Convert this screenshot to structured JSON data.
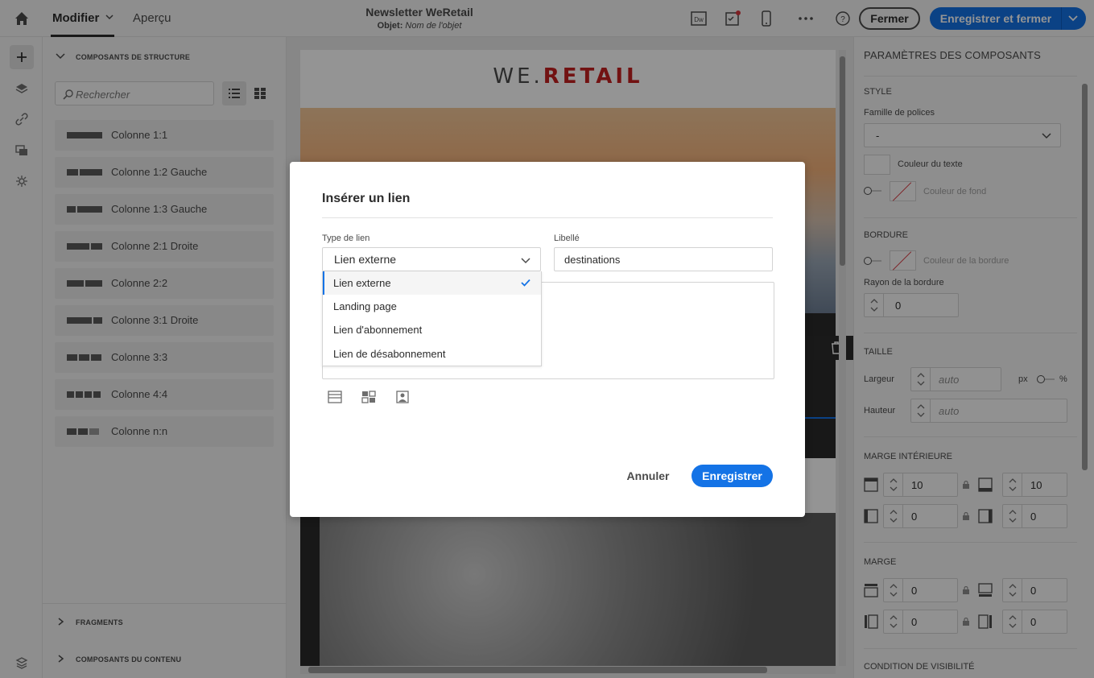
{
  "topbar": {
    "tabs": [
      {
        "label": "Modifier"
      },
      {
        "label": "Aperçu"
      }
    ],
    "doc_title": "Newsletter WeRetail",
    "subject_label": "Objet:",
    "subject_value": "Nom de l'objet",
    "close_label": "Fermer",
    "save_close_label": "Enregistrer et fermer",
    "dw_label": "Dw"
  },
  "left_panel": {
    "structure_title": "COMPOSANTS DE STRUCTURE",
    "search_placeholder": "Rechercher",
    "items": [
      {
        "label": "Colonne 1:1"
      },
      {
        "label": "Colonne 1:2 Gauche"
      },
      {
        "label": "Colonne 1:3 Gauche"
      },
      {
        "label": "Colonne 2:1 Droite"
      },
      {
        "label": "Colonne 2:2"
      },
      {
        "label": "Colonne 3:1 Droite"
      },
      {
        "label": "Colonne 3:3"
      },
      {
        "label": "Colonne 4:4"
      },
      {
        "label": "Colonne n:n"
      }
    ],
    "fragments_title": "FRAGMENTS",
    "content_title": "COMPOSANTS DU CONTENU"
  },
  "canvas": {
    "logo_left": "WE.",
    "logo_right": "RETAIL"
  },
  "right_panel": {
    "title": "PARAMÈTRES DES COMPOSANTS",
    "style": "STYLE",
    "font_family": "Famille de polices",
    "font_value": "-",
    "text_color": "Couleur du texte",
    "bg_color": "Couleur de fond",
    "border": "BORDURE",
    "border_color": "Couleur de la bordure",
    "border_radius": "Rayon de la bordure",
    "border_radius_value": "0",
    "size": "TAILLE",
    "width": "Largeur",
    "height": "Hauteur",
    "auto": "auto",
    "unit_px": "px",
    "unit_pct": "%",
    "padding": "MARGE INTÉRIEURE",
    "padding_top": "10",
    "padding_bottom": "10",
    "padding_left": "0",
    "padding_right": "0",
    "margin": "MARGE",
    "margin_top": "0",
    "margin_bottom": "0",
    "margin_left": "0",
    "margin_right": "0",
    "visibility": "CONDITION DE VISIBILITÉ"
  },
  "dialog": {
    "title": "Insérer un lien",
    "link_type_label": "Type de lien",
    "link_type_value": "Lien externe",
    "label_label": "Libellé",
    "label_value": "destinations",
    "options": [
      {
        "label": "Lien externe",
        "selected": true
      },
      {
        "label": "Landing page"
      },
      {
        "label": "Lien d'abonnement"
      },
      {
        "label": "Lien de désabonnement"
      }
    ],
    "cancel": "Annuler",
    "save": "Enregistrer"
  },
  "colors": {
    "accent": "#1473e6",
    "brand_red": "#c41f1f"
  }
}
